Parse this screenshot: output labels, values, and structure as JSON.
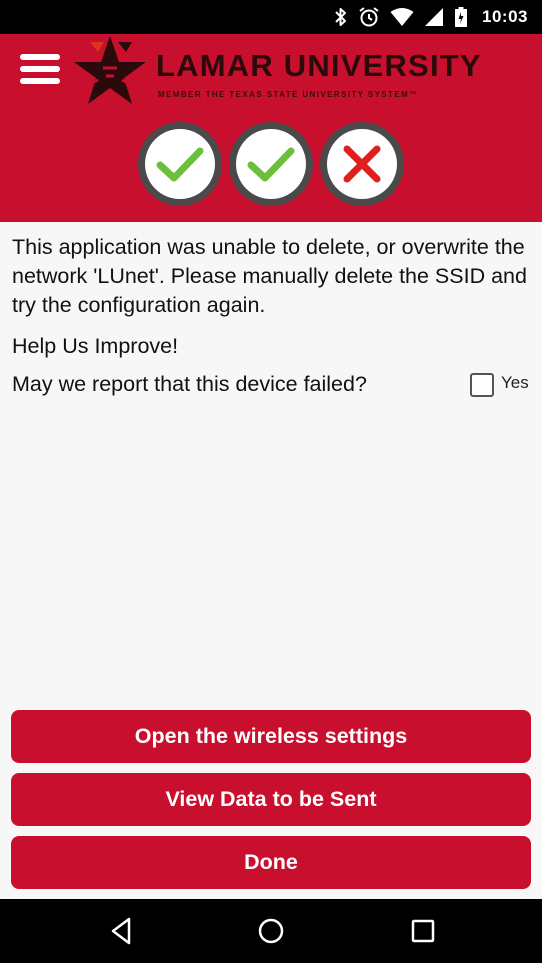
{
  "status_bar": {
    "time": "10:03",
    "icons": [
      "bluetooth-icon",
      "alarm-icon",
      "wifi-icon",
      "signal-icon",
      "battery-icon"
    ]
  },
  "header": {
    "background": "#c8102e",
    "logo_title": "LAMAR UNIVERSITY",
    "logo_subtitle": "MEMBER THE TEXAS STATE UNIVERSITY SYSTEM™",
    "steps": [
      {
        "status": "success",
        "icon": "check-icon"
      },
      {
        "status": "success",
        "icon": "check-icon"
      },
      {
        "status": "failed",
        "icon": "x-icon"
      }
    ]
  },
  "content": {
    "message": "This application was unable to delete, or overwrite the network 'LUnet'.   Please manually delete the SSID and try the configuration again.",
    "improve_heading": "Help Us Improve!",
    "report_question": "May we report that this device failed?",
    "report_checkbox": {
      "label": "Yes",
      "checked": false
    }
  },
  "buttons": {
    "open_wireless": "Open the wireless settings",
    "view_data": "View Data to be Sent",
    "done": "Done"
  },
  "nav": {
    "icons": [
      "back-icon",
      "home-icon",
      "recents-icon"
    ]
  },
  "colors": {
    "accent": "#c8102e",
    "check_green": "#6bbf3a",
    "x_red": "#e0201e"
  }
}
